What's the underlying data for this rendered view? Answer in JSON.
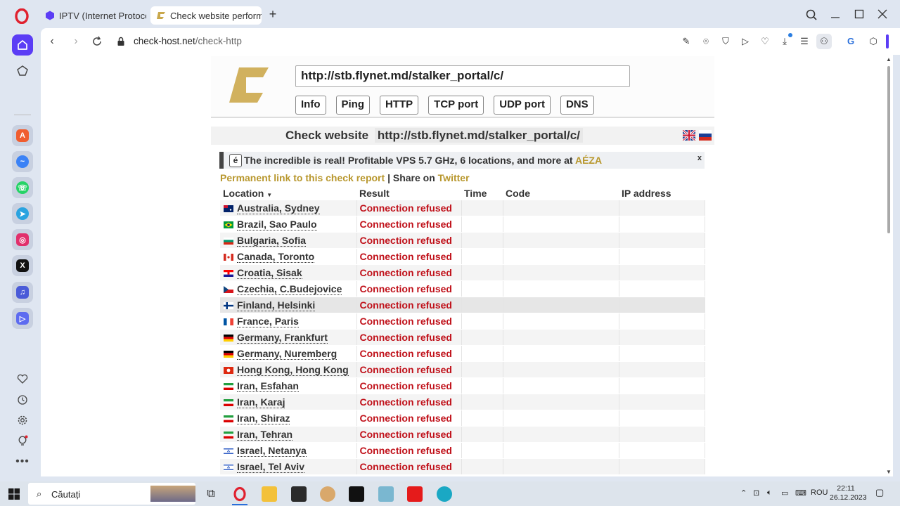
{
  "tabs": [
    {
      "title": "IPTV (Internet Protocol T",
      "active": false,
      "icon": "hexagon-icon"
    },
    {
      "title": "Check website performa",
      "active": true,
      "icon": "check-host-icon"
    }
  ],
  "address_bar": {
    "domain": "check-host.net",
    "path": "/check-http"
  },
  "check_form": {
    "url_value": "http://stb.flynet.md/stalker_portal/c/",
    "buttons": [
      "Info",
      "Ping",
      "HTTP",
      "TCP port",
      "UDP port",
      "DNS"
    ]
  },
  "check_header": {
    "label": "Check website",
    "url": "http://stb.flynet.md/stalker_portal/c/"
  },
  "ad": {
    "badge": "é",
    "text": "The incredible is real! Profitable VPS 5.7 GHz, 6 locations, and more at",
    "link": "AÉZA",
    "close": "x"
  },
  "links": {
    "permalink": "Permanent link to this check report",
    "separator": "|",
    "share_prefix": "Share on",
    "share_link": "Twitter"
  },
  "table": {
    "headers": {
      "location": "Location",
      "sort_marker": "▼",
      "result": "Result",
      "time": "Time",
      "code": "Code",
      "ip": "IP address"
    },
    "rows": [
      {
        "location": "Australia, Sydney",
        "result": "Connection refused",
        "flag": "au"
      },
      {
        "location": "Brazil, Sao Paulo",
        "result": "Connection refused",
        "flag": "br"
      },
      {
        "location": "Bulgaria, Sofia",
        "result": "Connection refused",
        "flag": "bg"
      },
      {
        "location": "Canada, Toronto",
        "result": "Connection refused",
        "flag": "ca"
      },
      {
        "location": "Croatia, Sisak",
        "result": "Connection refused",
        "flag": "hr"
      },
      {
        "location": "Czechia, C.Budejovice",
        "result": "Connection refused",
        "flag": "cz"
      },
      {
        "location": "Finland, Helsinki",
        "result": "Connection refused",
        "flag": "fi",
        "highlight": true
      },
      {
        "location": "France, Paris",
        "result": "Connection refused",
        "flag": "fr"
      },
      {
        "location": "Germany, Frankfurt",
        "result": "Connection refused",
        "flag": "de"
      },
      {
        "location": "Germany, Nuremberg",
        "result": "Connection refused",
        "flag": "de"
      },
      {
        "location": "Hong Kong, Hong Kong",
        "result": "Connection refused",
        "flag": "hk"
      },
      {
        "location": "Iran, Esfahan",
        "result": "Connection refused",
        "flag": "ir"
      },
      {
        "location": "Iran, Karaj",
        "result": "Connection refused",
        "flag": "ir"
      },
      {
        "location": "Iran, Shiraz",
        "result": "Connection refused",
        "flag": "ir"
      },
      {
        "location": "Iran, Tehran",
        "result": "Connection refused",
        "flag": "ir"
      },
      {
        "location": "Israel, Netanya",
        "result": "Connection refused",
        "flag": "il"
      },
      {
        "location": "Israel, Tel Aviv",
        "result": "Connection refused",
        "flag": "il"
      }
    ]
  },
  "taskbar": {
    "search_placeholder": "Căutați",
    "language": "ROU",
    "time": "22:11",
    "date": "26.12.2023"
  },
  "colors": {
    "accent_gold": "#b8972d",
    "error_red": "#c0111a",
    "opera_red": "#e0212f",
    "sidebar_purple": "#5b3df5"
  }
}
